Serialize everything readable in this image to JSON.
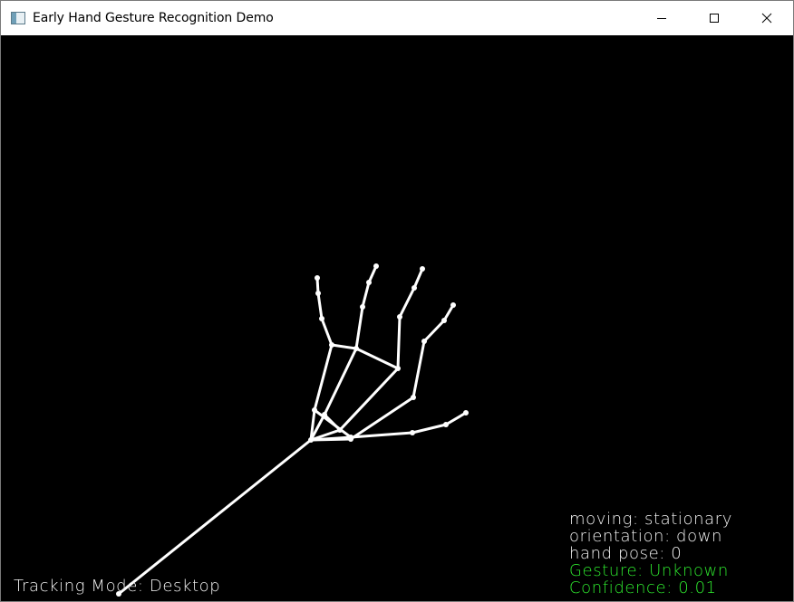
{
  "window": {
    "title": "Early Hand Gesture Recognition Demo",
    "icon": "app-window-icon",
    "controls": [
      "minimize-icon",
      "maximize-icon",
      "close-icon"
    ]
  },
  "status": {
    "moving": "moving: stationary",
    "orientation": "orientation: down",
    "hand_pose": "hand pose: 0",
    "gesture": "Gesture: Unknown",
    "confidence": "Confidence: 0.01"
  },
  "tracking_mode": "Tracking Mode: Desktop",
  "colors": {
    "background": "#000000",
    "skeleton": "#ffffff",
    "status_text": "#f2f2f2",
    "gesture_text": "#2ee82e"
  }
}
